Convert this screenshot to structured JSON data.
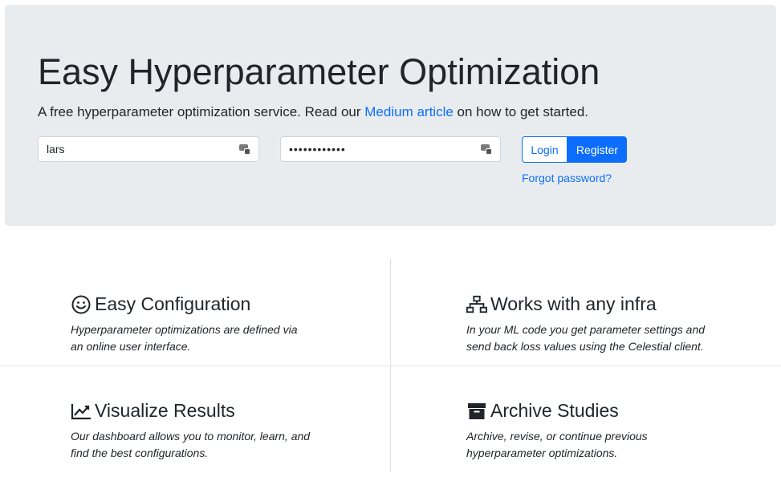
{
  "hero": {
    "title": "Easy Hyperparameter Optimization",
    "lead_before": "A free hyperparameter optimization service. Read our ",
    "lead_link": "Medium article",
    "lead_after": " on how to get started."
  },
  "login_form": {
    "username_value": "lars",
    "password_value": "••••••••••••",
    "login_label": "Login",
    "register_label": "Register",
    "forgot_label": "Forgot password?"
  },
  "features": [
    {
      "icon": "smile-icon",
      "title": "Easy Configuration",
      "line1": "Hyperparameter optimizations are defined via",
      "line2": "an online user interface."
    },
    {
      "icon": "network-icon",
      "title": "Works with any infra",
      "line1": "In your ML code you get parameter settings and",
      "line2": "send back loss values using the Celestial client."
    },
    {
      "icon": "chart-line-icon",
      "title": "Visualize Results",
      "line1": "Our dashboard allows you to monitor, learn, and",
      "line2": "find the best configurations."
    },
    {
      "icon": "archive-icon",
      "title": "Archive Studies",
      "line1": "Archive, revise, or continue previous",
      "line2": "hyperparameter optimizations."
    }
  ],
  "colors": {
    "accent": "#0d6efd",
    "jumbotron_bg": "#e9ecef"
  }
}
